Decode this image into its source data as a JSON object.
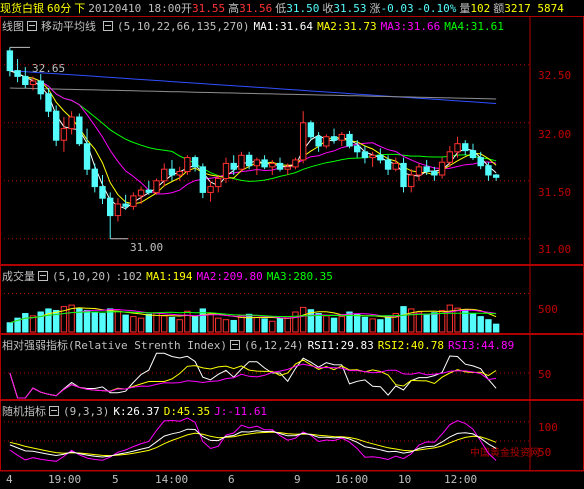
{
  "topbar": {
    "symbol": "现货白银",
    "period": "60分",
    "arrow": "下",
    "datetime": "20120410 18:00",
    "open_label": "开",
    "open": "31.55",
    "high_label": "高",
    "high": "31.56",
    "low_label": "低",
    "low": "31.50",
    "close_label": "收",
    "close": "31.53",
    "change_label": "涨",
    "change": "-0.03",
    "change_pct": "-0.10%",
    "volume_label": "量",
    "volume": "102",
    "amount_label": "额",
    "amount": "3217 5874"
  },
  "main_panel": {
    "title": "线图",
    "indicator_name": "移动平均线",
    "params": "(5,10,22,66,135,270)",
    "ma1": "MA1:31.64",
    "ma2": "MA2:31.73",
    "ma3": "MA3:31.66",
    "ma4": "MA4:31.61",
    "max_label": "32.65",
    "min_label": "31.00",
    "y_ticks": [
      "32.50",
      "32.00",
      "31.50",
      "31.00"
    ]
  },
  "volume_panel": {
    "title": "成交量",
    "params": "(5,10,20)",
    "current": ":102",
    "ma1": "MA1:194",
    "ma2": "MA2:209.80",
    "ma3": "MA3:280.35",
    "y_ticks": [
      "500"
    ]
  },
  "rsi_panel": {
    "title": "相对强弱指标(Relative Strenth Index)",
    "params": "(6,12,24)",
    "rsi1": "RSI1:29.83",
    "rsi2": "RSI2:40.78",
    "rsi3": "RSI3:44.89",
    "y_ticks": [
      "50"
    ]
  },
  "kdj_panel": {
    "title": "随机指标",
    "params": "(9,3,3)",
    "k": "K:26.37",
    "d": "D:45.35",
    "j": "J:-11.61",
    "y_ticks": [
      "100",
      "50"
    ]
  },
  "x_axis": [
    "4",
    "19:00",
    "5",
    "14:00",
    "6",
    "9",
    "16:00",
    "10",
    "12:00"
  ],
  "watermark": "中国黄金投资网",
  "colors": {
    "up": "#ff3232",
    "down": "#54fcfc",
    "ma1": "#ffffff",
    "ma2": "#ffff00",
    "ma3": "#ff00ff",
    "ma4": "#00ff00",
    "ma5": "#3050ff",
    "ma6": "#909090",
    "grid": "#b00000"
  },
  "chart_data": {
    "type": "candlestick",
    "y_range": [
      30.8,
      32.8
    ],
    "candles": [
      [
        32.62,
        32.65,
        32.4,
        32.45
      ],
      [
        32.45,
        32.55,
        32.35,
        32.4
      ],
      [
        32.4,
        32.48,
        32.3,
        32.33
      ],
      [
        32.33,
        32.4,
        32.28,
        32.36
      ],
      [
        32.36,
        32.42,
        32.2,
        32.25
      ],
      [
        32.25,
        32.3,
        32.05,
        32.1
      ],
      [
        32.1,
        32.15,
        31.8,
        31.85
      ],
      [
        31.85,
        32.05,
        31.75,
        31.95
      ],
      [
        31.95,
        32.1,
        31.9,
        32.05
      ],
      [
        32.05,
        32.08,
        31.8,
        31.82
      ],
      [
        31.82,
        31.95,
        31.55,
        31.6
      ],
      [
        31.6,
        31.65,
        31.4,
        31.45
      ],
      [
        31.45,
        31.55,
        31.3,
        31.35
      ],
      [
        31.35,
        31.4,
        31.0,
        31.2
      ],
      [
        31.2,
        31.35,
        31.15,
        31.3
      ],
      [
        31.3,
        31.38,
        31.25,
        31.28
      ],
      [
        31.28,
        31.4,
        31.25,
        31.37
      ],
      [
        31.37,
        31.45,
        31.3,
        31.42
      ],
      [
        31.42,
        31.5,
        31.38,
        31.4
      ],
      [
        31.4,
        31.52,
        31.38,
        31.5
      ],
      [
        31.5,
        31.65,
        31.45,
        31.6
      ],
      [
        31.6,
        31.68,
        31.5,
        31.55
      ],
      [
        31.55,
        31.62,
        31.5,
        31.58
      ],
      [
        31.58,
        31.72,
        31.55,
        31.7
      ],
      [
        31.7,
        31.72,
        31.58,
        31.62
      ],
      [
        31.62,
        31.65,
        31.35,
        31.4
      ],
      [
        31.4,
        31.5,
        31.32,
        31.45
      ],
      [
        31.45,
        31.55,
        31.4,
        31.52
      ],
      [
        31.52,
        31.7,
        31.48,
        31.65
      ],
      [
        31.65,
        31.72,
        31.55,
        31.6
      ],
      [
        31.6,
        31.75,
        31.58,
        31.72
      ],
      [
        31.72,
        31.75,
        31.6,
        31.63
      ],
      [
        31.63,
        31.7,
        31.55,
        31.68
      ],
      [
        31.68,
        31.72,
        31.6,
        31.62
      ],
      [
        31.62,
        31.68,
        31.55,
        31.65
      ],
      [
        31.65,
        31.7,
        31.58,
        31.6
      ],
      [
        31.6,
        31.65,
        31.55,
        31.62
      ],
      [
        31.62,
        31.7,
        31.6,
        31.68
      ],
      [
        31.68,
        32.1,
        31.65,
        32.0
      ],
      [
        32.0,
        32.02,
        31.85,
        31.88
      ],
      [
        31.88,
        31.92,
        31.75,
        31.8
      ],
      [
        31.8,
        31.9,
        31.78,
        31.88
      ],
      [
        31.88,
        31.95,
        31.82,
        31.85
      ],
      [
        31.85,
        31.92,
        31.8,
        31.9
      ],
      [
        31.9,
        31.93,
        31.78,
        31.8
      ],
      [
        31.8,
        31.85,
        31.7,
        31.75
      ],
      [
        31.75,
        31.8,
        31.65,
        31.7
      ],
      [
        31.7,
        31.75,
        31.62,
        31.72
      ],
      [
        31.72,
        31.78,
        31.65,
        31.68
      ],
      [
        31.68,
        31.72,
        31.55,
        31.6
      ],
      [
        31.6,
        31.7,
        31.58,
        31.65
      ],
      [
        31.65,
        31.7,
        31.4,
        31.45
      ],
      [
        31.45,
        31.6,
        31.4,
        31.55
      ],
      [
        31.55,
        31.65,
        31.5,
        31.62
      ],
      [
        31.62,
        31.68,
        31.55,
        31.58
      ],
      [
        31.58,
        31.62,
        31.5,
        31.55
      ],
      [
        31.55,
        31.7,
        31.52,
        31.66
      ],
      [
        31.66,
        31.8,
        31.62,
        31.75
      ],
      [
        31.75,
        31.88,
        31.7,
        31.82
      ],
      [
        31.82,
        31.85,
        31.72,
        31.76
      ],
      [
        31.76,
        31.82,
        31.68,
        31.7
      ],
      [
        31.7,
        31.75,
        31.6,
        31.63
      ],
      [
        31.63,
        31.66,
        31.5,
        31.55
      ],
      [
        31.55,
        31.56,
        31.5,
        31.53
      ]
    ],
    "volume": [
      120,
      180,
      240,
      210,
      260,
      300,
      280,
      330,
      350,
      310,
      280,
      260,
      240,
      300,
      270,
      220,
      200,
      180,
      230,
      250,
      210,
      190,
      160,
      270,
      200,
      300,
      240,
      180,
      160,
      150,
      210,
      230,
      190,
      170,
      140,
      180,
      200,
      260,
      320,
      290,
      240,
      210,
      180,
      200,
      260,
      230,
      190,
      170,
      160,
      210,
      240,
      330,
      300,
      260,
      220,
      250,
      280,
      350,
      310,
      290,
      240,
      200,
      160,
      102
    ],
    "volume_ylim": [
      0,
      650
    ]
  }
}
